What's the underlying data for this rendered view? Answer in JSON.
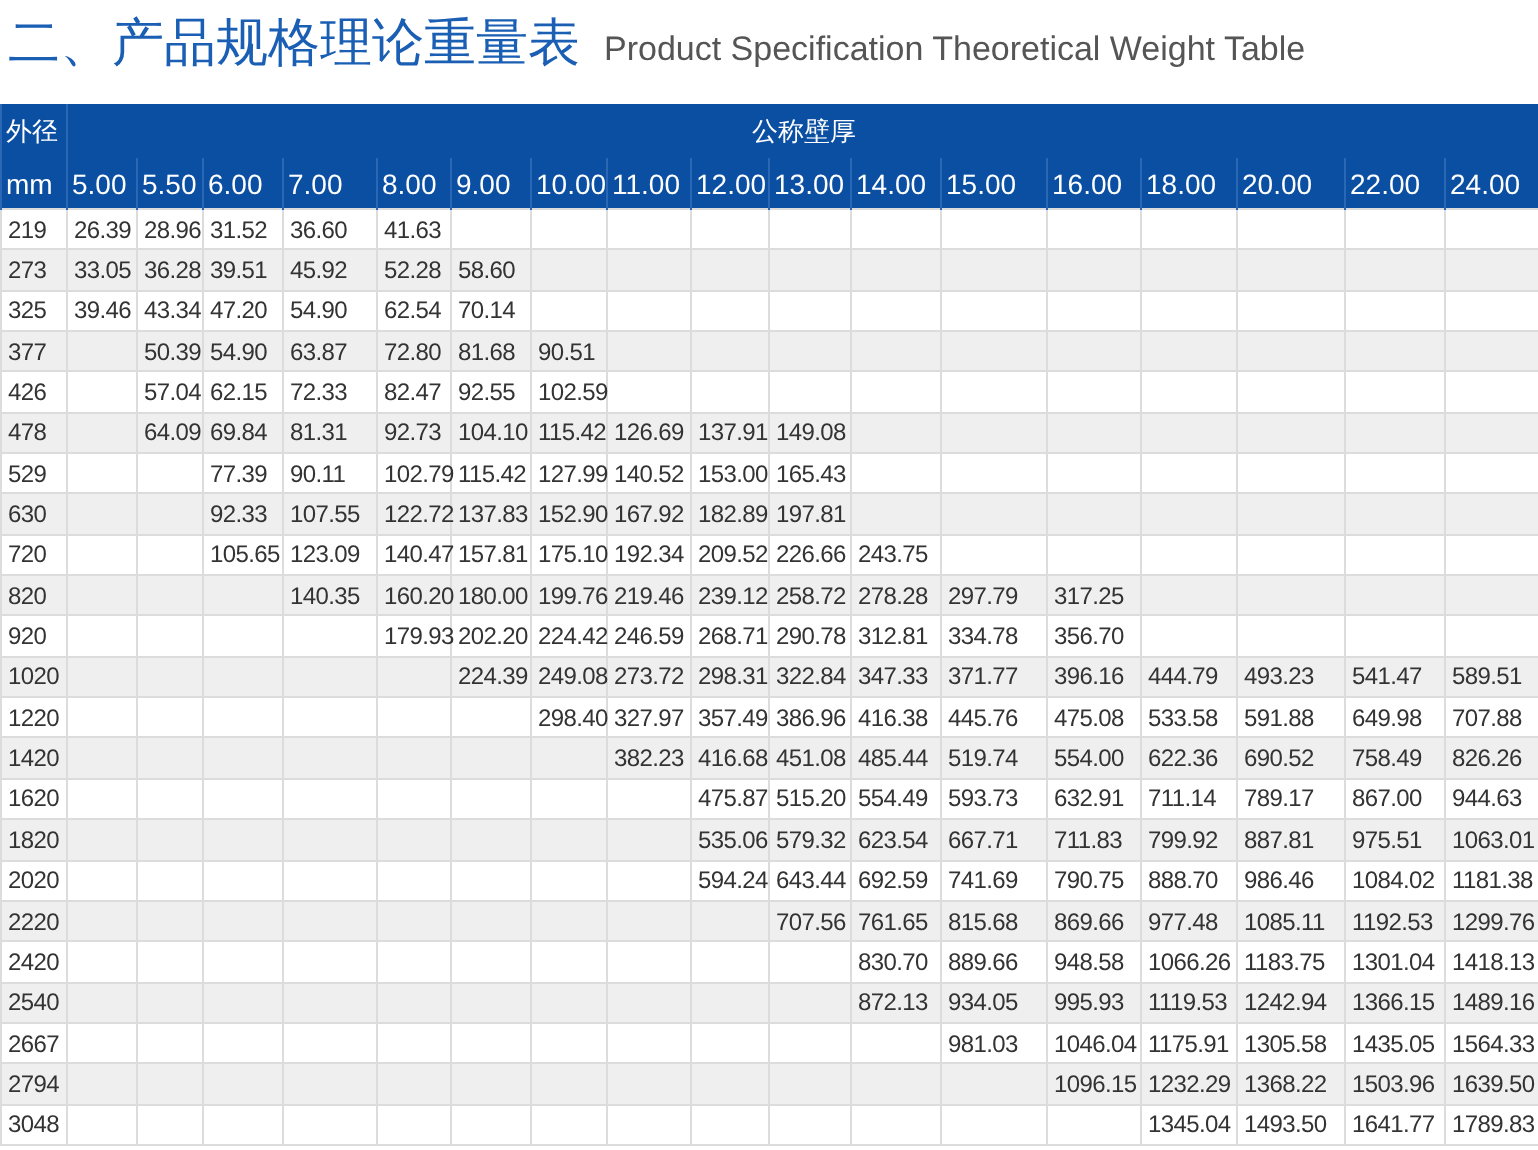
{
  "title": {
    "heading": "二、产品规格理论重量表",
    "subtitle": "Product Specification Theoretical Weight Table"
  },
  "table": {
    "corner_top": "外径",
    "group_header": "公称壁厚",
    "corner_bottom": "mm",
    "columns": [
      "5.00",
      "5.50",
      "6.00",
      "7.00",
      "8.00",
      "9.00",
      "10.00",
      "11.00",
      "12.00",
      "13.00",
      "14.00",
      "15.00",
      "16.00",
      "18.00",
      "20.00",
      "22.00",
      "24.00"
    ],
    "rows": [
      {
        "diameter": "219",
        "cells": [
          "26.39",
          "28.96",
          "31.52",
          "36.60",
          "41.63",
          null,
          null,
          null,
          null,
          null,
          null,
          null,
          null,
          null,
          null,
          null,
          null
        ]
      },
      {
        "diameter": "273",
        "cells": [
          "33.05",
          "36.28",
          "39.51",
          "45.92",
          "52.28",
          "58.60",
          null,
          null,
          null,
          null,
          null,
          null,
          null,
          null,
          null,
          null,
          null
        ]
      },
      {
        "diameter": "325",
        "cells": [
          "39.46",
          "43.34",
          "47.20",
          "54.90",
          "62.54",
          "70.14",
          null,
          null,
          null,
          null,
          null,
          null,
          null,
          null,
          null,
          null,
          null
        ]
      },
      {
        "diameter": "377",
        "cells": [
          null,
          "50.39",
          "54.90",
          "63.87",
          "72.80",
          "81.68",
          "90.51",
          null,
          null,
          null,
          null,
          null,
          null,
          null,
          null,
          null,
          null
        ]
      },
      {
        "diameter": "426",
        "cells": [
          null,
          "57.04",
          "62.15",
          "72.33",
          "82.47",
          "92.55",
          "102.59",
          null,
          null,
          null,
          null,
          null,
          null,
          null,
          null,
          null,
          null
        ]
      },
      {
        "diameter": "478",
        "cells": [
          null,
          "64.09",
          "69.84",
          "81.31",
          "92.73",
          "104.10",
          "115.42",
          "126.69",
          "137.91",
          "149.08",
          null,
          null,
          null,
          null,
          null,
          null,
          null
        ]
      },
      {
        "diameter": "529",
        "cells": [
          null,
          null,
          "77.39",
          "90.11",
          "102.79",
          "115.42",
          "127.99",
          "140.52",
          "153.00",
          "165.43",
          null,
          null,
          null,
          null,
          null,
          null,
          null
        ]
      },
      {
        "diameter": "630",
        "cells": [
          null,
          null,
          "92.33",
          "107.55",
          "122.72",
          "137.83",
          "152.90",
          "167.92",
          "182.89",
          "197.81",
          null,
          null,
          null,
          null,
          null,
          null,
          null
        ]
      },
      {
        "diameter": "720",
        "cells": [
          null,
          null,
          "105.65",
          "123.09",
          "140.47",
          "157.81",
          "175.10",
          "192.34",
          "209.52",
          "226.66",
          "243.75",
          null,
          null,
          null,
          null,
          null,
          null
        ]
      },
      {
        "diameter": "820",
        "cells": [
          null,
          null,
          null,
          "140.35",
          "160.20",
          "180.00",
          "199.76",
          "219.46",
          "239.12",
          "258.72",
          "278.28",
          "297.79",
          "317.25",
          null,
          null,
          null,
          null
        ]
      },
      {
        "diameter": "920",
        "cells": [
          null,
          null,
          null,
          null,
          "179.93",
          "202.20",
          "224.42",
          "246.59",
          "268.71",
          "290.78",
          "312.81",
          "334.78",
          "356.70",
          null,
          null,
          null,
          null
        ]
      },
      {
        "diameter": "1020",
        "cells": [
          null,
          null,
          null,
          null,
          null,
          "224.39",
          "249.08",
          "273.72",
          "298.31",
          "322.84",
          "347.33",
          "371.77",
          "396.16",
          "444.79",
          "493.23",
          "541.47",
          "589.51"
        ]
      },
      {
        "diameter": "1220",
        "cells": [
          null,
          null,
          null,
          null,
          null,
          null,
          "298.40",
          "327.97",
          "357.49",
          "386.96",
          "416.38",
          "445.76",
          "475.08",
          "533.58",
          "591.88",
          "649.98",
          "707.88"
        ]
      },
      {
        "diameter": "1420",
        "cells": [
          null,
          null,
          null,
          null,
          null,
          null,
          null,
          "382.23",
          "416.68",
          "451.08",
          "485.44",
          "519.74",
          "554.00",
          "622.36",
          "690.52",
          "758.49",
          "826.26"
        ]
      },
      {
        "diameter": "1620",
        "cells": [
          null,
          null,
          null,
          null,
          null,
          null,
          null,
          null,
          "475.87",
          "515.20",
          "554.49",
          "593.73",
          "632.91",
          "711.14",
          "789.17",
          "867.00",
          "944.63"
        ]
      },
      {
        "diameter": "1820",
        "cells": [
          null,
          null,
          null,
          null,
          null,
          null,
          null,
          null,
          "535.06",
          "579.32",
          "623.54",
          "667.71",
          "711.83",
          "799.92",
          "887.81",
          "975.51",
          "1063.01"
        ]
      },
      {
        "diameter": "2020",
        "cells": [
          null,
          null,
          null,
          null,
          null,
          null,
          null,
          null,
          "594.24",
          "643.44",
          "692.59",
          "741.69",
          "790.75",
          "888.70",
          "986.46",
          "1084.02",
          "1181.38"
        ]
      },
      {
        "diameter": "2220",
        "cells": [
          null,
          null,
          null,
          null,
          null,
          null,
          null,
          null,
          null,
          "707.56",
          "761.65",
          "815.68",
          "869.66",
          "977.48",
          "1085.11",
          "1192.53",
          "1299.76"
        ]
      },
      {
        "diameter": "2420",
        "cells": [
          null,
          null,
          null,
          null,
          null,
          null,
          null,
          null,
          null,
          null,
          "830.70",
          "889.66",
          "948.58",
          "1066.26",
          "1183.75",
          "1301.04",
          "1418.13"
        ]
      },
      {
        "diameter": "2540",
        "cells": [
          null,
          null,
          null,
          null,
          null,
          null,
          null,
          null,
          null,
          null,
          "872.13",
          "934.05",
          "995.93",
          "1119.53",
          "1242.94",
          "1366.15",
          "1489.16"
        ]
      },
      {
        "diameter": "2667",
        "cells": [
          null,
          null,
          null,
          null,
          null,
          null,
          null,
          null,
          null,
          null,
          null,
          "981.03",
          "1046.04",
          "1175.91",
          "1305.58",
          "1435.05",
          "1564.33"
        ]
      },
      {
        "diameter": "2794",
        "cells": [
          null,
          null,
          null,
          null,
          null,
          null,
          null,
          null,
          null,
          null,
          null,
          null,
          "1096.15",
          "1232.29",
          "1368.22",
          "1503.96",
          "1639.50"
        ]
      },
      {
        "diameter": "3048",
        "cells": [
          null,
          null,
          null,
          null,
          null,
          null,
          null,
          null,
          null,
          null,
          null,
          null,
          null,
          "1345.04",
          "1493.50",
          "1641.77",
          "1789.83"
        ]
      }
    ]
  }
}
